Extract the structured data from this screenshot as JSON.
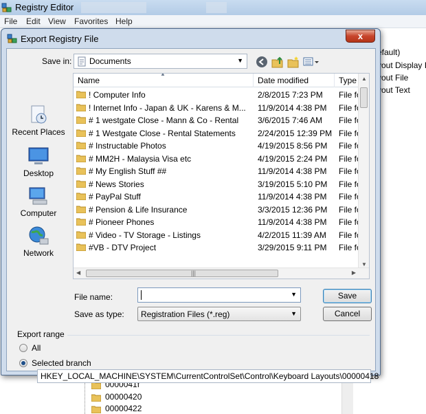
{
  "registry_editor": {
    "title": "Registry Editor",
    "menu": [
      "File",
      "Edit",
      "View",
      "Favorites",
      "Help"
    ],
    "right_pane_items": [
      "efault)",
      "yout Display I",
      "yout File",
      "yout Text"
    ],
    "tree_items": [
      "0000041f",
      "00000420",
      "00000422"
    ]
  },
  "dialog": {
    "title": "Export Registry File",
    "close_label": "x",
    "save_in_label": "Save in:",
    "save_in_value": "Documents",
    "places": [
      "Recent Places",
      "Desktop",
      "Computer",
      "Network"
    ],
    "columns": [
      "Name",
      "Date modified",
      "Type"
    ],
    "files": [
      {
        "name": "! Computer Info",
        "date": "2/8/2015 7:23 PM",
        "type": "File fol"
      },
      {
        "name": "! Internet Info - Japan & UK - Karens & M...",
        "date": "11/9/2014 4:38 PM",
        "type": "File fol"
      },
      {
        "name": "# 1 westgate Close - Mann & Co - Rental",
        "date": "3/6/2015 7:46 AM",
        "type": "File fol"
      },
      {
        "name": "# 1 Westgate Close - Rental Statements",
        "date": "2/24/2015 12:39 PM",
        "type": "File fol"
      },
      {
        "name": "# Instructable Photos",
        "date": "4/19/2015 8:56 PM",
        "type": "File fol"
      },
      {
        "name": "# MM2H - Malaysia Visa etc",
        "date": "4/19/2015 2:24 PM",
        "type": "File fol"
      },
      {
        "name": "# My English Stuff ##",
        "date": "11/9/2014 4:38 PM",
        "type": "File fol"
      },
      {
        "name": "# News Stories",
        "date": "3/19/2015 5:10 PM",
        "type": "File fol"
      },
      {
        "name": "# PayPal Stuff",
        "date": "11/9/2014 4:38 PM",
        "type": "File fol"
      },
      {
        "name": "# Pension & Life Insurance",
        "date": "3/3/2015 12:36 PM",
        "type": "File fol"
      },
      {
        "name": "# Pioneer Phones",
        "date": "11/9/2014 4:38 PM",
        "type": "File fol"
      },
      {
        "name": "# Video - TV Storage - Listings",
        "date": "4/2/2015 11:39 AM",
        "type": "File fol"
      },
      {
        "name": "#VB - DTV Project",
        "date": "3/29/2015 9:11 PM",
        "type": "File fol"
      }
    ],
    "file_name_label": "File name:",
    "file_name_value": "",
    "save_as_type_label": "Save as type:",
    "save_as_type_value": "Registration Files (*.reg)",
    "save_button": "Save",
    "cancel_button": "Cancel",
    "export_range_title": "Export range",
    "radio_all_label": "All",
    "radio_selected_label": "Selected branch",
    "selected_branch_value": "HKEY_LOCAL_MACHINE\\SYSTEM\\CurrentControlSet\\Control\\Keyboard Layouts\\00000418",
    "selected_option": "Selected branch"
  },
  "colors": {
    "dialog_frame": "#cfdcec",
    "close_button": "#c7452c",
    "folder": "#e9c25a",
    "default_button_border": "#3c7fb1"
  }
}
